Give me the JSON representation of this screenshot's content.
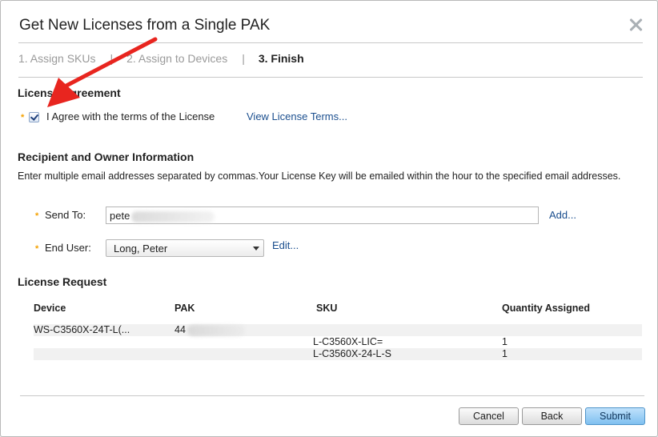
{
  "dialog": {
    "title": "Get New Licenses from a Single PAK",
    "close_icon": "close-icon"
  },
  "steps": [
    {
      "label": "1. Assign SKUs",
      "active": false
    },
    {
      "label": "2. Assign to Devices",
      "active": false
    },
    {
      "label": "3. Finish",
      "active": true
    }
  ],
  "step_separator": "|",
  "license_agreement": {
    "heading": "License Agreement",
    "required_mark": "*",
    "checkbox_checked": true,
    "checkbox_label": "I Agree with the terms of the License",
    "view_terms_link": "View License Terms..."
  },
  "recipient": {
    "heading": "Recipient and Owner Information",
    "description": "Enter multiple email addresses separated by commas.Your License Key will be emailed within the hour to the specified email addresses.",
    "send_to_label": "Send To:",
    "send_to_value": "pete",
    "add_link": "Add...",
    "end_user_label": "End User:",
    "end_user_value": "Long, Peter",
    "edit_link": "Edit..."
  },
  "license_request": {
    "heading": "License Request",
    "columns": [
      "Device",
      "PAK",
      "SKU",
      "Quantity Assigned"
    ],
    "device": "WS-C3560X-24T-L(...",
    "pak": "44",
    "skus": [
      {
        "sku": "L-C3560X-LIC=",
        "quantity": "1"
      },
      {
        "sku": "L-C3560X-24-L-S",
        "quantity": "1"
      }
    ]
  },
  "buttons": {
    "cancel": "Cancel",
    "back": "Back",
    "submit": "Submit"
  },
  "colors": {
    "annotation_arrow": "#e8251f",
    "required_mark": "#f4a100",
    "link": "#1a4e8e",
    "primary_button": "#7fc0f0"
  }
}
